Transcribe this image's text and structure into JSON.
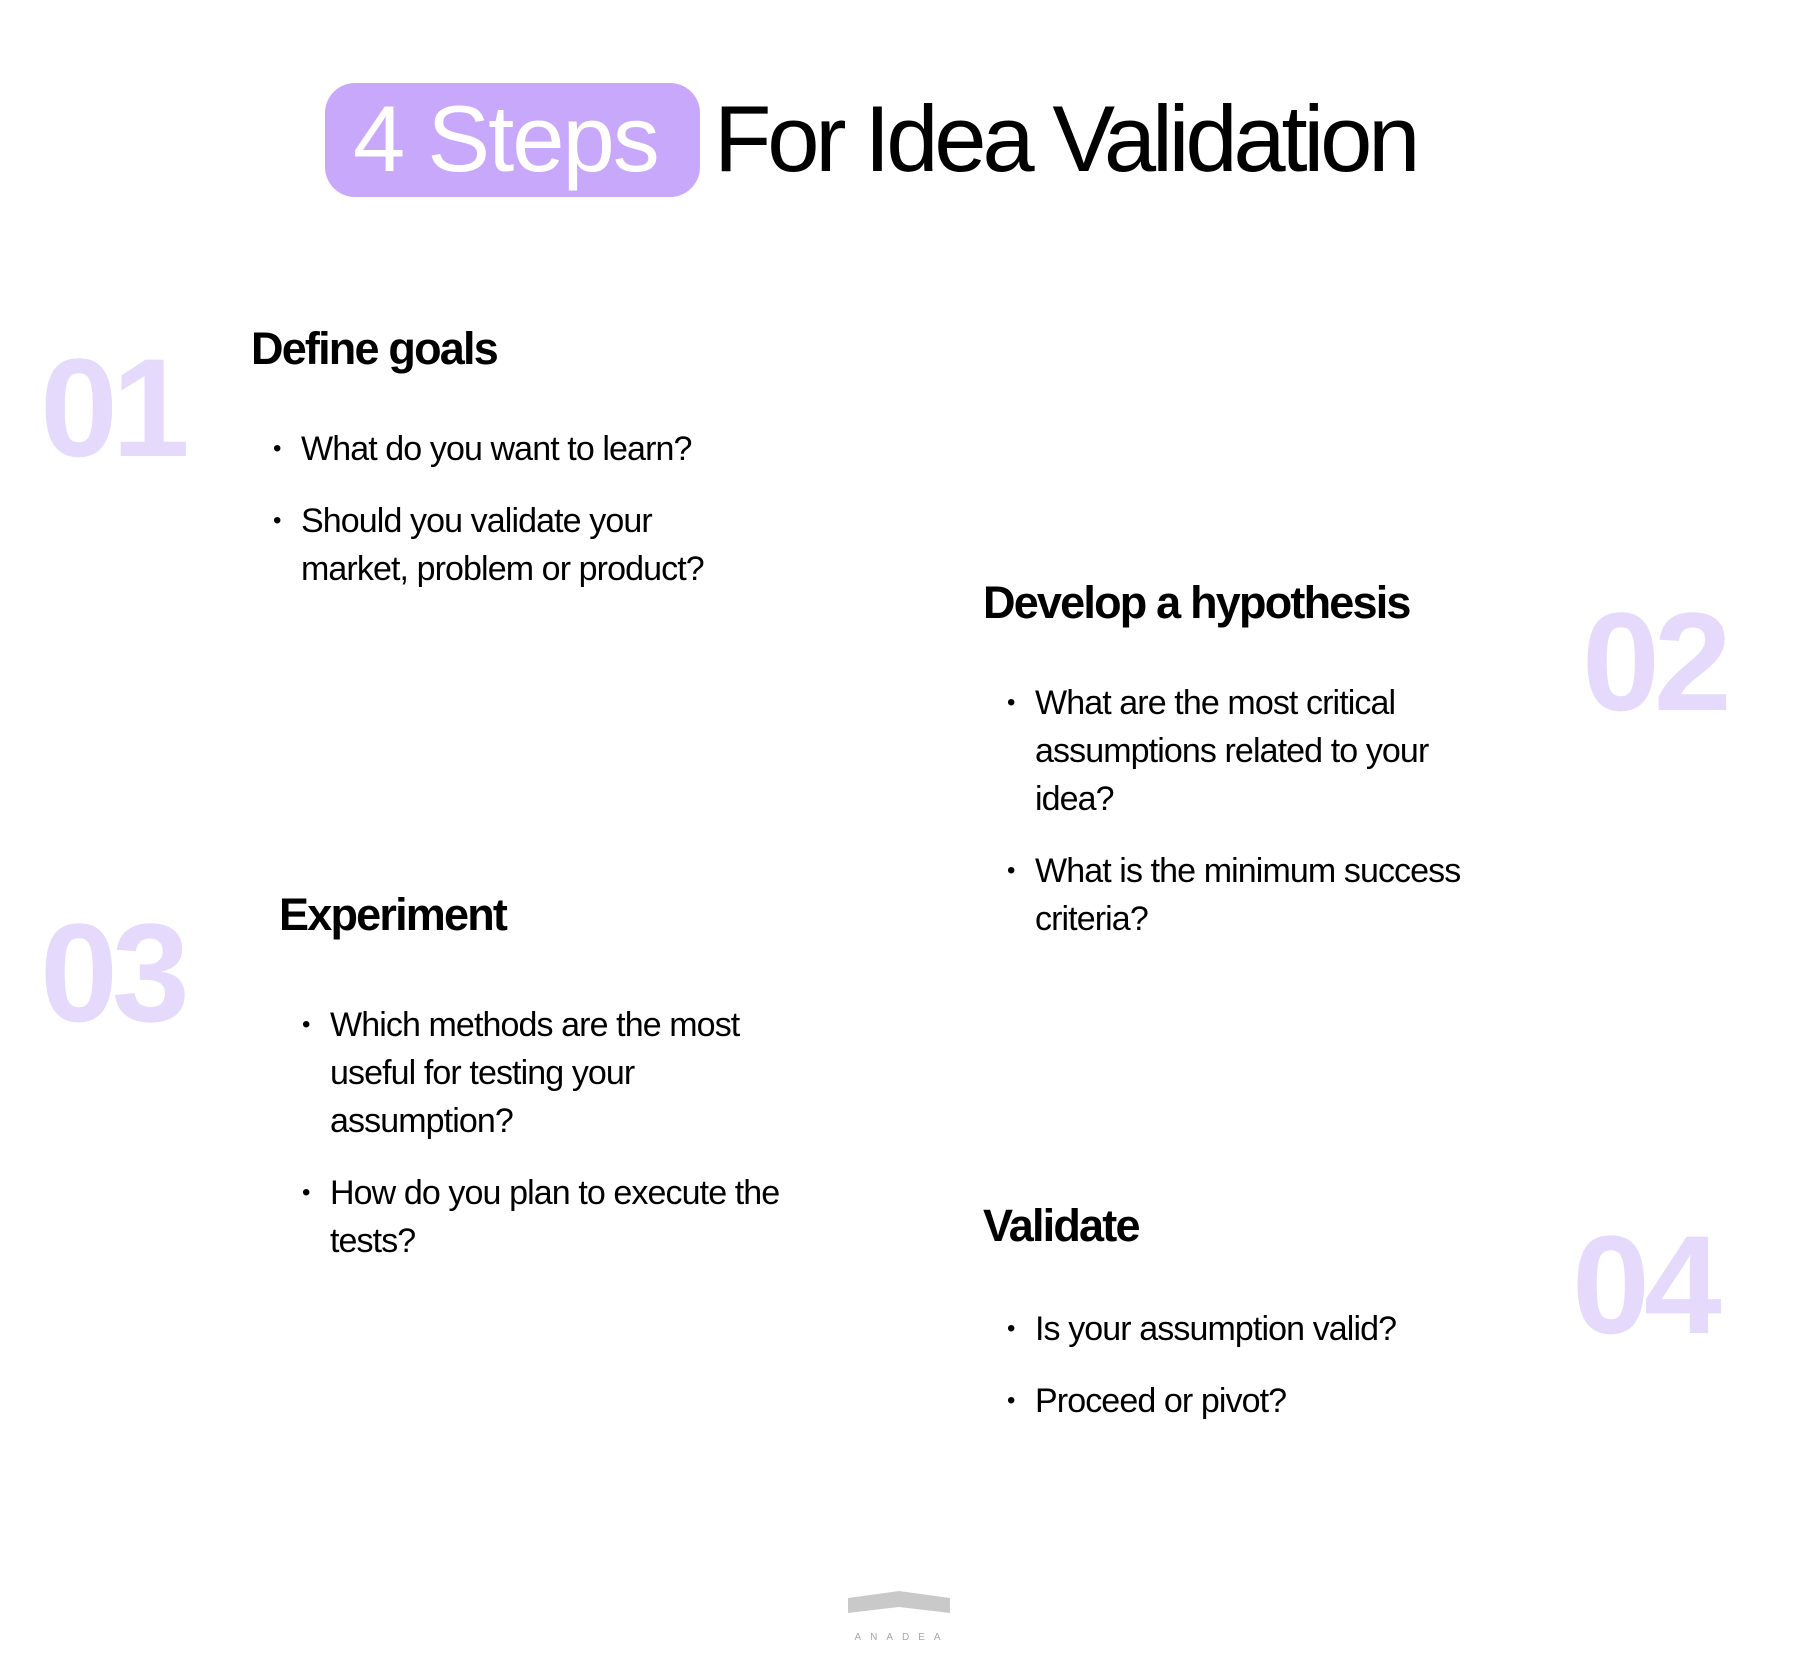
{
  "title": {
    "highlight": "4 Steps",
    "rest": "For Idea Validation"
  },
  "colors": {
    "pill": "#c8a8fb",
    "step_number": "#e6dafc",
    "text": "#000000"
  },
  "steps": [
    {
      "number": "01",
      "heading": "Define goals",
      "bullets": [
        "What do you want to learn?",
        "Should you validate your market, problem or product?"
      ]
    },
    {
      "number": "02",
      "heading": "Develop a hypothesis",
      "bullets": [
        "What are the most critical assumptions related to your idea?",
        "What is the minimum success criteria?"
      ]
    },
    {
      "number": "03",
      "heading": "Experiment",
      "bullets": [
        "Which methods are the most useful for testing your assumption?",
        "How do you plan to execute the tests?"
      ]
    },
    {
      "number": "04",
      "heading": "Validate",
      "bullets": [
        "Is your assumption valid?",
        "Proceed or pivot?"
      ]
    }
  ],
  "bullet_glyph": "•",
  "footer": {
    "logo_text": "ANADEA"
  }
}
